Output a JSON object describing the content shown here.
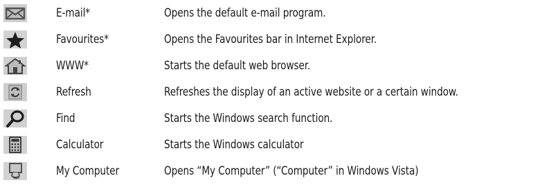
{
  "rows": [
    {
      "icon": "envelope-icon",
      "label": "E-mail*",
      "description": "Opens the default e-mail program."
    },
    {
      "icon": "star-icon",
      "label": "Favourites*",
      "description": "Opens the Favourites bar in Internet Explorer."
    },
    {
      "icon": "house-icon",
      "label": "WWW*",
      "description": "Starts the default web browser."
    },
    {
      "icon": "refresh-icon",
      "label": "Refresh",
      "description": "Refreshes the display of an active website or a certain window."
    },
    {
      "icon": "magnifier-icon",
      "label": "Find",
      "description": "Starts the Windows search function."
    },
    {
      "icon": "calculator-icon",
      "label": "Calculator",
      "description": "Starts the Windows calculator"
    },
    {
      "icon": "my-computer-icon",
      "label": "My Computer",
      "description": "Opens “My Computer” (“Computer” in Windows Vista)"
    }
  ],
  "colors": {
    "icon_background": "#c8c8c8",
    "icon_glyph": "#2a2a2a",
    "text": "#1a1a1a"
  }
}
